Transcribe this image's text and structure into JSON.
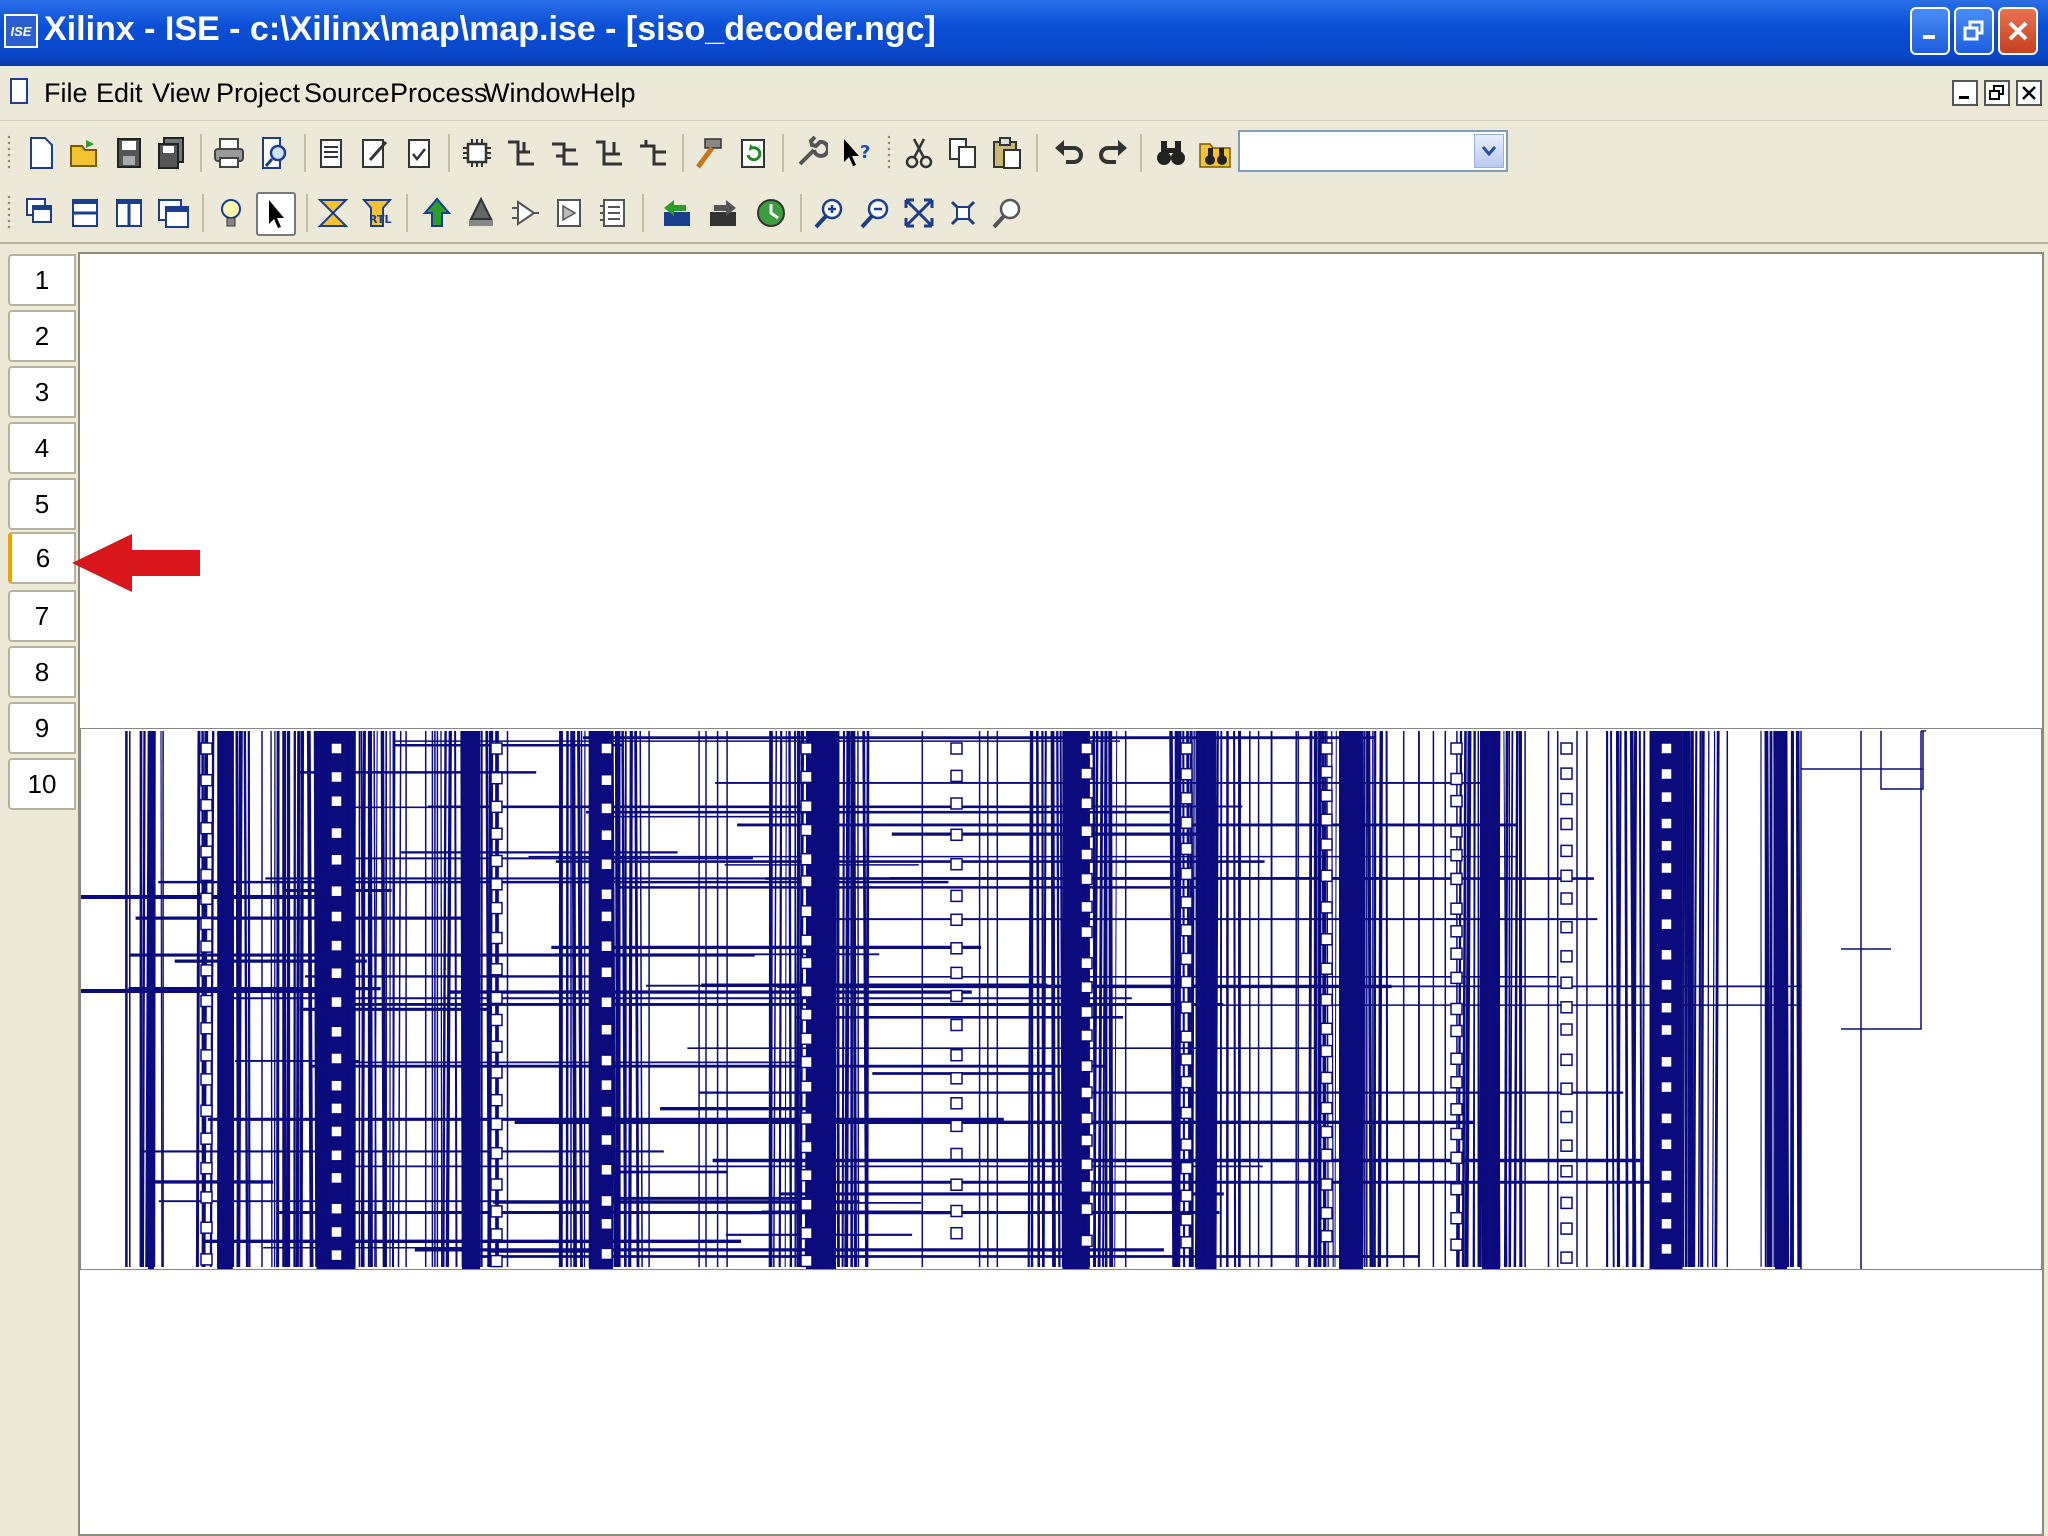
{
  "titlebar": {
    "logo_text": "ISE",
    "title": "Xilinx - ISE - c:\\Xilinx\\map\\map.ise - [siso_decoder.ngc]"
  },
  "menubar": {
    "items": [
      "File",
      "Edit",
      "View",
      "Project",
      "Source",
      "Process",
      "Window",
      "Help"
    ]
  },
  "toolbar": {
    "search_value": ""
  },
  "sheet_tabs": {
    "labels": [
      "1",
      "2",
      "3",
      "4",
      "5",
      "6",
      "7",
      "8",
      "9",
      "10"
    ],
    "active": "6"
  },
  "colors": {
    "wire": "#0b0b7d",
    "titlebar": "#0a4fd6",
    "annotation_arrow": "#d8161c",
    "active_tab_marker": "#f2a000"
  },
  "icons": {
    "toolbar_1": [
      "new-file-icon",
      "open-file-icon",
      "save-icon",
      "save-all-icon",
      "print-icon",
      "print-preview-icon",
      "new-source-icon",
      "edit-source-icon",
      "check-icon",
      "symbol-icon",
      "net-icon-1",
      "net-icon-2",
      "net-icon-3",
      "net-icon-4",
      "hammer-icon",
      "refresh-icon",
      "wrench-icon",
      "help-pointer-icon",
      "cut-icon",
      "copy-icon",
      "paste-icon",
      "undo-icon",
      "redo-icon",
      "find-icon",
      "find-in-files-icon"
    ],
    "toolbar_2": [
      "cascade-windows-icon",
      "tile-horizontal-icon",
      "tile-vertical-icon",
      "window-icon",
      "hint-bulb-icon",
      "select-tool-icon",
      "timing-icon",
      "rtl-icon",
      "push-up-icon",
      "push-down-icon",
      "expand-icon",
      "collapse-icon",
      "hierarchy-icon",
      "back-icon",
      "forward-icon",
      "globe-icon",
      "zoom-in-icon",
      "zoom-out-icon",
      "zoom-full-icon",
      "zoom-fit-icon",
      "zoom-select-icon"
    ]
  }
}
